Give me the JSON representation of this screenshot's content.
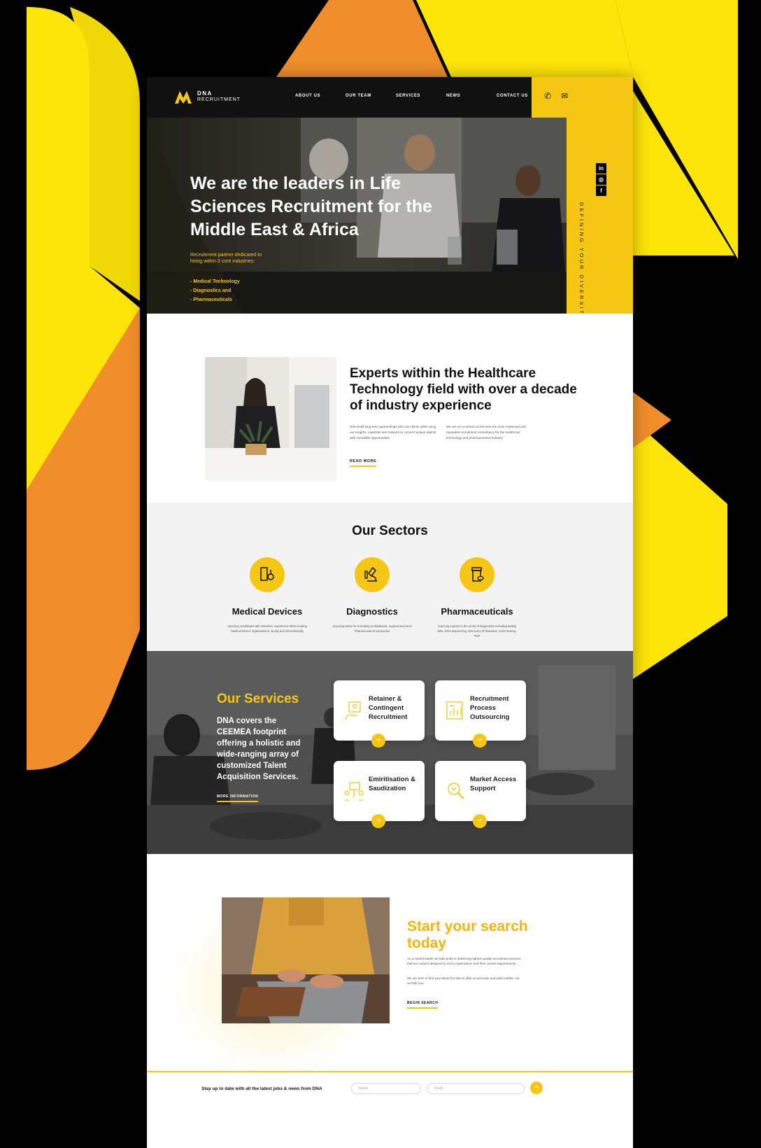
{
  "colors": {
    "brand_yellow": "#f6c615",
    "brand_orange": "#ef8e2a",
    "dark": "#111111",
    "light_grey": "#f3f3f3"
  },
  "header": {
    "logo_word": "DNA",
    "logo_sub": "RECRUITMENT",
    "nav": [
      "ABOUT US",
      "OUR TEAM",
      "SERVICES",
      "NEWS",
      "CONTACT US"
    ],
    "icons": [
      "phone-icon",
      "mail-icon"
    ]
  },
  "hero": {
    "title": "We are the leaders in Life Sciences Recruitment for the Middle East & Africa",
    "subtitle": "Recruitment partner dedicated to hiring within 3 core industries:",
    "industries": [
      "- Medical Technology",
      "- Diagnostics and",
      "- Pharmaceuticals"
    ],
    "vertical_text": "DEFINING YOUR DIVERSITY"
  },
  "social": [
    "in",
    "◎",
    "f"
  ],
  "experts": {
    "title": "Experts within the Healthcare Technology field with over a decade of industry experience",
    "col1": "DNA build long-term partnerships with our clients while using our insights, expertise and network to connect unique talents with incredible opportunities.",
    "col2": "We are on a mission to become the most respected and reputable recruitment consultancy for the healthcare technology and pharmaceutical industry.",
    "read_more": "READ MORE"
  },
  "sectors": {
    "title": "Our Sectors",
    "items": [
      {
        "name": "Medical Devices",
        "desc": "Sourcing candidates with extensive experience within leading Medical Device organisations, locally and internationally",
        "icon": "medical-device-icon"
      },
      {
        "name": "Diagnostics",
        "desc": "Sourcing talent for to leading multinational, regional and local Pharmaceutical companies",
        "icon": "microscope-icon"
      },
      {
        "name": "Pharmaceuticals",
        "desc": "Sourcing experts in the areas of diagnostics including testing labs, DNA sequencing, Discovery of Diseases, Covid testing, PCR",
        "icon": "pill-bottle-icon"
      }
    ]
  },
  "services": {
    "title": "Our Services",
    "text": "DNA covers the CEEMEA footprint offering a holistic and wide-ranging array of customized Talent Acquisition Services.",
    "more": "MORE INFORMATION",
    "cards": [
      {
        "label": "Retainer & Contingent Recruitment",
        "icon": "candidate-icon"
      },
      {
        "label": "Recruitment Process Outsourcing",
        "icon": "process-chart-icon"
      },
      {
        "label": "Emiritisation & Saudization",
        "icon": "people-network-icon"
      },
      {
        "label": "Market Access Support",
        "icon": "magnifier-icon"
      }
    ]
  },
  "search": {
    "title": "Start your search today",
    "p1": "As a market leader we take pride in delivering highest quality recruitment services that are custom designed to every organisation and their current requirements.",
    "p2": "We are here to find your talent but also to offer an accurate and valid market. Let us help you.",
    "button": "BEGIN SEARCH"
  },
  "newsletter": {
    "text": "Stay up to date with all the latest jobs & news from DNA",
    "name_placeholder": "Name",
    "email_placeholder": "Email"
  }
}
